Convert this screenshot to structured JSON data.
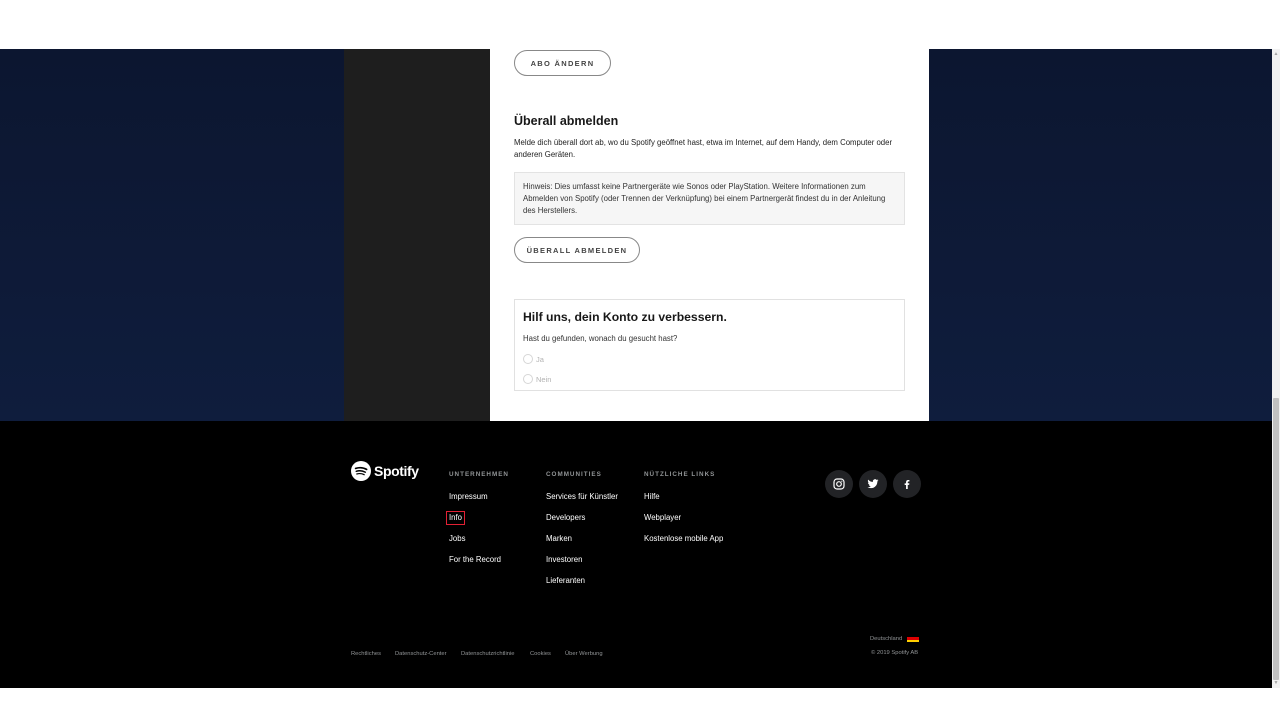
{
  "account": {
    "change_plan_button": "ABO ÄNDERN",
    "signout_everywhere": {
      "title": "Überall abmelden",
      "description": "Melde dich überall dort ab, wo du Spotify geöffnet hast, etwa im Internet, auf dem Handy, dem Computer oder anderen Geräten.",
      "note": "Hinweis: Dies umfasst keine Partnergeräte wie Sonos oder PlayStation. Weitere Informationen zum Abmelden von Spotify (oder Trennen der Verknüpfung) bei einem Partnergerät findest du in der Anleitung des Herstellers.",
      "button": "ÜBERALL ABMELDEN"
    },
    "feedback": {
      "title": "Hilf uns, dein Konto zu verbessern.",
      "question": "Hast du gefunden, wonach du gesucht hast?",
      "options": [
        "Ja",
        "Nein"
      ]
    }
  },
  "footer": {
    "logo_text": "Spotify",
    "columns": [
      {
        "heading": "UNTERNEHMEN",
        "links": [
          "Impressum",
          "Info",
          "Jobs",
          "For the Record"
        ]
      },
      {
        "heading": "COMMUNITIES",
        "links": [
          "Services für Künstler",
          "Developers",
          "Marken",
          "Investoren",
          "Lieferanten"
        ]
      },
      {
        "heading": "NÜTZLICHE LINKS",
        "links": [
          "Hilfe",
          "Webplayer",
          "Kostenlose mobile App"
        ]
      }
    ],
    "social_icons": [
      "instagram-icon",
      "twitter-icon",
      "facebook-icon"
    ],
    "legal_links": [
      "Rechtliches",
      "Datenschutz-Center",
      "Datenschutzrichtlinie",
      "Cookies",
      "Über Werbung"
    ],
    "country": "Deutschland",
    "copyright": "© 2019 Spotify AB"
  },
  "colors": {
    "spotify_green": "#1ed760",
    "highlight_red": "#e22134",
    "band_navy": "#0c1630"
  }
}
